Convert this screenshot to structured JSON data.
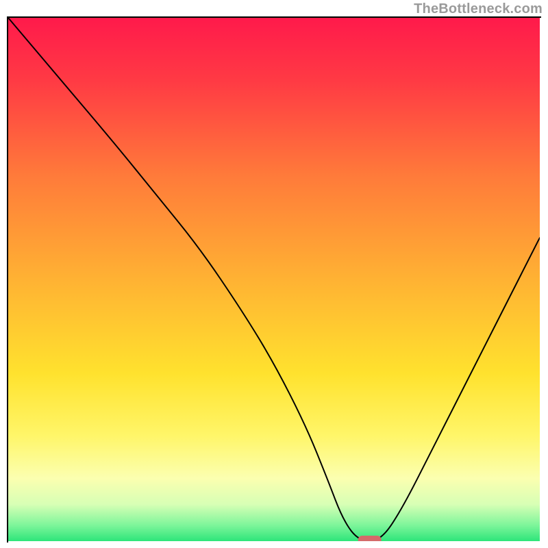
{
  "watermark": "TheBottleneck.com",
  "chart_data": {
    "type": "line",
    "title": "",
    "xlabel": "",
    "ylabel": "",
    "xlim": [
      0,
      100
    ],
    "ylim": [
      0,
      100
    ],
    "grid": false,
    "legend": false,
    "background": "vertical-gradient red→yellow→green",
    "gradient_stops": [
      {
        "offset": 0.0,
        "color": "#ff1a4b"
      },
      {
        "offset": 0.12,
        "color": "#ff3a44"
      },
      {
        "offset": 0.3,
        "color": "#ff7a3a"
      },
      {
        "offset": 0.5,
        "color": "#ffb233"
      },
      {
        "offset": 0.68,
        "color": "#ffe22e"
      },
      {
        "offset": 0.8,
        "color": "#fff66a"
      },
      {
        "offset": 0.88,
        "color": "#fbffb0"
      },
      {
        "offset": 0.93,
        "color": "#d7ffb5"
      },
      {
        "offset": 0.97,
        "color": "#7cf59a"
      },
      {
        "offset": 1.0,
        "color": "#2de57a"
      }
    ],
    "series": [
      {
        "name": "bottleneck-curve",
        "x": [
          0,
          10,
          20,
          28,
          36,
          44,
          50,
          56,
          60,
          63,
          66,
          70,
          74,
          80,
          88,
          96,
          100
        ],
        "y": [
          100,
          88,
          76,
          66,
          56,
          44,
          34,
          22,
          12,
          4,
          0,
          0,
          6,
          18,
          34,
          50,
          58
        ]
      }
    ],
    "marker": {
      "x": 68,
      "y": 0,
      "shape": "capsule",
      "color": "#d46a6a"
    }
  }
}
